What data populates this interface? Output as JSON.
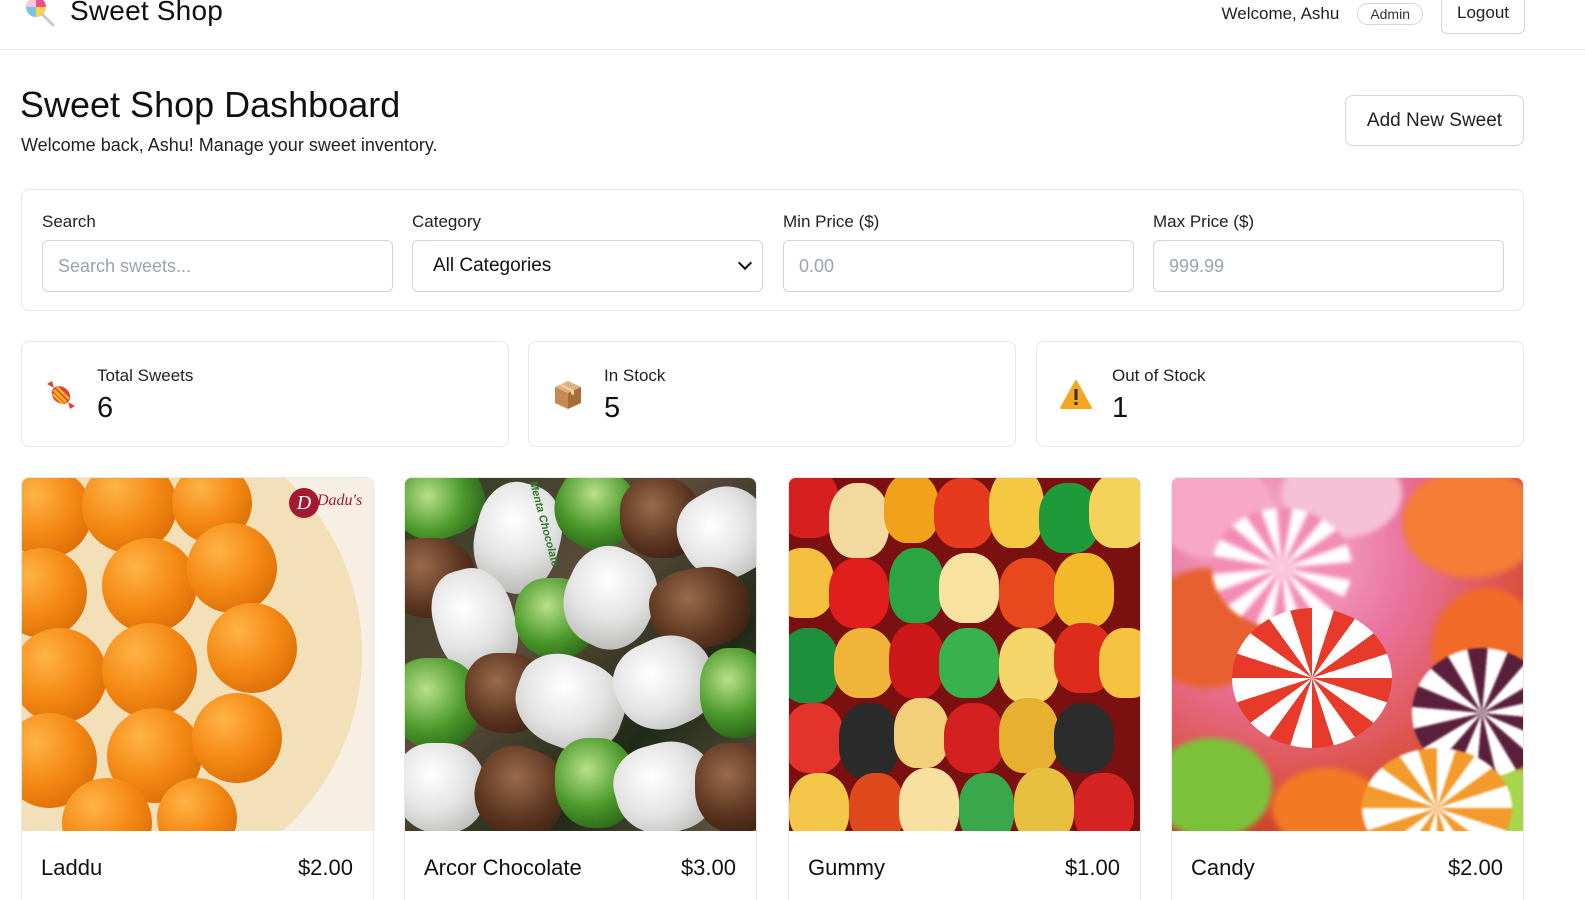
{
  "navbar": {
    "brand": "Sweet Shop",
    "welcome": "Welcome, Ashu",
    "role": "Admin",
    "logout_label": "Logout"
  },
  "header": {
    "title": "Sweet Shop Dashboard",
    "subtitle": "Welcome back, Ashu! Manage your sweet inventory.",
    "add_label": "Add New Sweet"
  },
  "filters": {
    "search": {
      "label": "Search",
      "placeholder": "Search sweets...",
      "value": ""
    },
    "category": {
      "label": "Category",
      "selected": "All Categories"
    },
    "min_price": {
      "label": "Min Price ($)",
      "placeholder": "0.00",
      "value": ""
    },
    "max_price": {
      "label": "Max Price ($)",
      "placeholder": "999.99",
      "value": ""
    }
  },
  "stats": [
    {
      "label": "Total Sweets",
      "value": "6",
      "icon": "candy-icon"
    },
    {
      "label": "In Stock",
      "value": "5",
      "icon": "package-icon"
    },
    {
      "label": "Out of Stock",
      "value": "1",
      "icon": "warning-icon"
    }
  ],
  "products": [
    {
      "name": "Laddu",
      "price": "$2.00",
      "logo": "Dadu's"
    },
    {
      "name": "Arcor Chocolate",
      "price": "$3.00",
      "wrapper_text": "Menta Chocolate"
    },
    {
      "name": "Gummy",
      "price": "$1.00"
    },
    {
      "name": "Candy",
      "price": "$2.00"
    }
  ],
  "colors": {
    "border": "#e5e7eb",
    "input_border": "#d1d5db",
    "placeholder": "#9ca3af",
    "warning": "#f5a623"
  }
}
